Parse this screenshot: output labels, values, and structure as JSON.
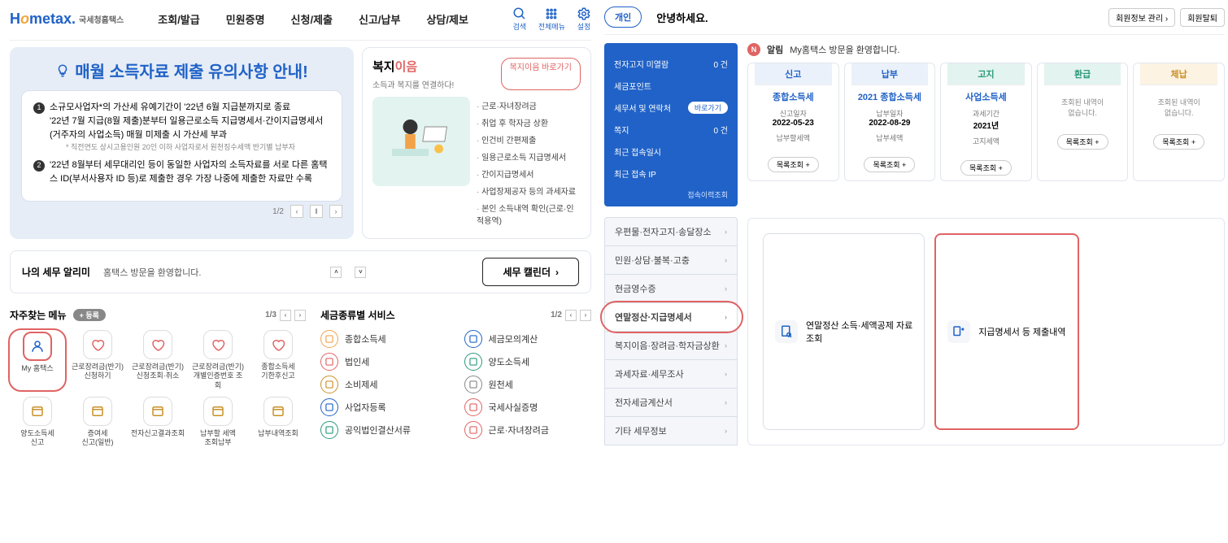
{
  "header": {
    "logo_main": "Hometax",
    "logo_sub": "국세청홈택스",
    "logo_tag": "국세청 홈택스",
    "menu": [
      "조회/발급",
      "민원증명",
      "신청/제출",
      "신고/납부",
      "상담/제보"
    ],
    "icons": [
      {
        "name": "search-icon",
        "label": "검색"
      },
      {
        "name": "allmenu-icon",
        "label": "전체메뉴"
      },
      {
        "name": "settings-icon",
        "label": "설정"
      }
    ]
  },
  "banner": {
    "title": "매월 소득자료 제출 유의사항 안내!",
    "items": [
      {
        "n": "1",
        "text": "소규모사업자*의 가산세 유예기간이 '22년 6월 지급분까지로 종료",
        "sub": "'22년 7월 지급(8월 제출)분부터 일용근로소득 지급명세서·간이지급명세서(거주자의 사업소득) 매월 미제출 시 가산세 부과",
        "note": "* 직전연도 상시고용인원 20인 이하 사업자로서 원천징수세액 반기별 납부자"
      },
      {
        "n": "2",
        "text": "'22년 8월부터 세무대리인 등이 동일한 사업자의 소득자료를 서로 다른 홈택스 ID(부서사용자 ID 등)로 제출한 경우 가장 나중에 제출한 자료만 수록"
      }
    ],
    "pager": "1/2",
    "pager_prev": "‹",
    "pager_pause": "‖",
    "pager_next": "›"
  },
  "welfare": {
    "title_a": "복지",
    "title_b": "이음",
    "sub": "소득과 복지를 연결하다!",
    "btn": "복지이음 바로가기",
    "list": [
      "근로·자녀장려금",
      "취업 후 학자금 상환",
      "인건비 간편제출",
      "일용근로소득 지급명세서",
      "간이지급명세서",
      "사업장제공자 등의 과세자료",
      "본인 소득내역 확인(근로·인적용역)"
    ]
  },
  "alarm": {
    "title": "나의 세무 알리미",
    "msg": "홈택스 방문을 환영합니다.",
    "cal": "세무 캘린더"
  },
  "quick": {
    "title": "자주찾는 메뉴",
    "add": "+ 등록",
    "page": "1/3",
    "items": [
      {
        "label": "My 홈택스",
        "hl": true
      },
      {
        "label": "근로장려금(반기)\n신청하기"
      },
      {
        "label": "근로장려금(반기)\n신청조회·취소"
      },
      {
        "label": "근로장려금(반기)\n개별인증번호 조회"
      },
      {
        "label": "종합소득세\n기한후신고"
      },
      {
        "label": "양도소득세\n신고"
      },
      {
        "label": "증여세\n신고(일반)"
      },
      {
        "label": "전자신고결과조회"
      },
      {
        "label": "납부할 세액\n조회납부"
      },
      {
        "label": "납부내역조회"
      }
    ]
  },
  "cat": {
    "title": "세금종류별 서비스",
    "page": "1/2",
    "items": [
      {
        "label": "종합소득세"
      },
      {
        "label": "세금모의계산"
      },
      {
        "label": "법인세"
      },
      {
        "label": "양도소득세"
      },
      {
        "label": "소비제세"
      },
      {
        "label": "원천세"
      },
      {
        "label": "사업자등록"
      },
      {
        "label": "국세사실증명"
      },
      {
        "label": "공익법인결산서류"
      },
      {
        "label": "근로·자녀장려금"
      }
    ]
  },
  "right": {
    "tab": "개인",
    "greet": "안녕하세요.",
    "btn1": "회원정보 관리 ›",
    "btn2": "회원탈퇴",
    "blue": [
      {
        "l": "전자고지 미열람",
        "v": "0 건"
      },
      {
        "l": "세금포인트",
        "v": ""
      },
      {
        "l": "세무서 및 연락처",
        "link": "바로가기"
      },
      {
        "l": "쪽지",
        "v": "0 건"
      },
      {
        "l": "최근 접속일시",
        "v": ""
      },
      {
        "l": "최근 접속 IP",
        "v": ""
      }
    ],
    "blue_foot": "접속이력조회",
    "ntc_label": "알림",
    "ntc_msg": "My홈택스 방문을 환영합니다.",
    "cards": [
      {
        "head": "신고",
        "title": "종합소득세",
        "l1": "신고일자",
        "v1": "2022-05-23",
        "l2": "납부할세액",
        "v2": "",
        "btn": "목록조회 +",
        "cls": "c1"
      },
      {
        "head": "납부",
        "title": "2021 종합소득세",
        "l1": "납부일자",
        "v1": "2022-08-29",
        "l2": "납부세액",
        "v2": "",
        "btn": "목록조회 +",
        "cls": "c2"
      },
      {
        "head": "고지",
        "title": "사업소득세",
        "l1": "과세기간",
        "v1": "2021년",
        "l2": "고지세액",
        "v2": "",
        "btn": "목록조회 +",
        "cls": "c3"
      },
      {
        "head": "환급",
        "empty": "조회된 내역이\n없습니다.",
        "btn": "목록조회 +",
        "cls": "c4"
      },
      {
        "head": "체납",
        "empty": "조회된 내역이\n없습니다.",
        "btn": "목록조회 +",
        "cls": "c5"
      }
    ],
    "vmenu": [
      "우편물·전자고지·송달장소",
      "민원·상담·불복·고충",
      "현금영수증",
      "연말정산·지급명세서",
      "복지이음·장려금·학자금상환",
      "과세자료·세무조사",
      "전자세금계산서",
      "기타 세무정보"
    ],
    "vmenu_active": 3,
    "opt1": "연말정산 소득·세액공제 자료\n조회",
    "opt2": "지급명세서 등 제출내역"
  }
}
